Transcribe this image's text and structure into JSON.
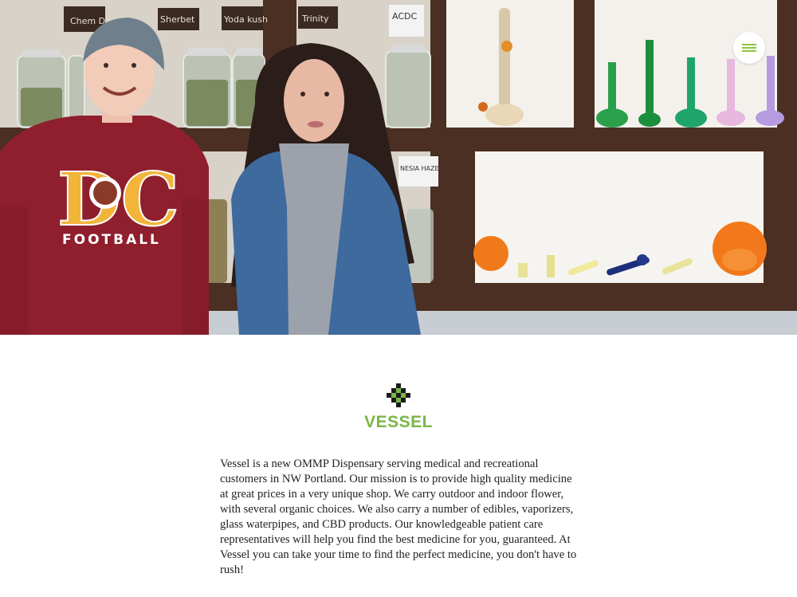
{
  "hero": {
    "shelf_labels": [
      "Chem Dawg",
      "Sherbet",
      "Yoda kush",
      "Trinity",
      "ACDC",
      "NESIA HAZE"
    ],
    "shirt_text": {
      "letters": "DC",
      "caption": "FOOTBALL"
    }
  },
  "header": {
    "menu_icon": "hamburger-icon"
  },
  "brand": {
    "name": "VESSEL",
    "mark_icon": "pixel-diamond-logo-icon",
    "color": "#7ab648"
  },
  "about": {
    "text": "Vessel is a new OMMP Dispensary serving medical and recreational customers in NW Portland. Our mission is to provide high quality medicine at great prices in a very unique shop. We carry outdoor and indoor flower, with several organic choices. We also carry a number of edibles, vaporizers, glass waterpipes, and CBD products. Our knowledgeable patient care representatives will help you find the best medicine for you, guaranteed. At Vessel you can take your time to find the perfect medicine, you don't have to rush!"
  },
  "colors": {
    "accent": "#8cc63f",
    "text": "#222222",
    "background": "#ffffff"
  }
}
